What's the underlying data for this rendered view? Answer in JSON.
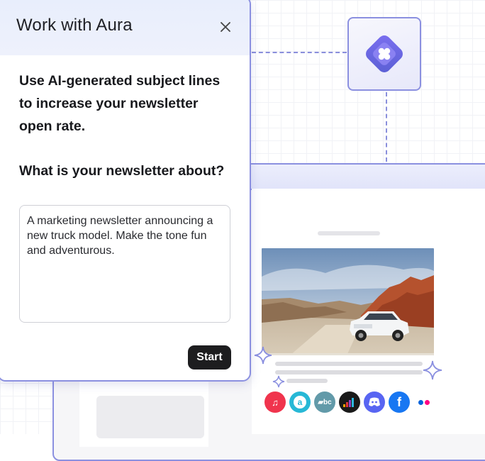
{
  "modal": {
    "title": "Work with Aura",
    "close_icon": "close-icon",
    "intro": "Use AI-generated subject lines to increase your newsletter open rate.",
    "question": "What is your newsletter about?",
    "textarea_value": "A marketing newsletter announcing a new truck model. Make the tone fun and adventurous.",
    "start_label": "Start"
  },
  "aura_logo": {
    "icon": "aura-logo-icon",
    "colors": [
      "#5b5fd6",
      "#8c8ff0"
    ]
  },
  "preview": {
    "image_subject": "white SUV on desert road with red rocks",
    "social_icons": [
      {
        "name": "music-icon",
        "color": "#f0344d"
      },
      {
        "name": "audible-icon",
        "color": "#27b8d6"
      },
      {
        "name": "bandcamp-icon",
        "color": "#629aa9"
      },
      {
        "name": "deezer-icon",
        "color": "#1a1a1a"
      },
      {
        "name": "discord-icon",
        "color": "#5865f2"
      },
      {
        "name": "facebook-icon",
        "color": "#1877f2"
      },
      {
        "name": "flickr-icon",
        "color": "#ffffff"
      }
    ]
  },
  "colors": {
    "accent": "#8b90e0",
    "button": "#1d1d1f"
  }
}
